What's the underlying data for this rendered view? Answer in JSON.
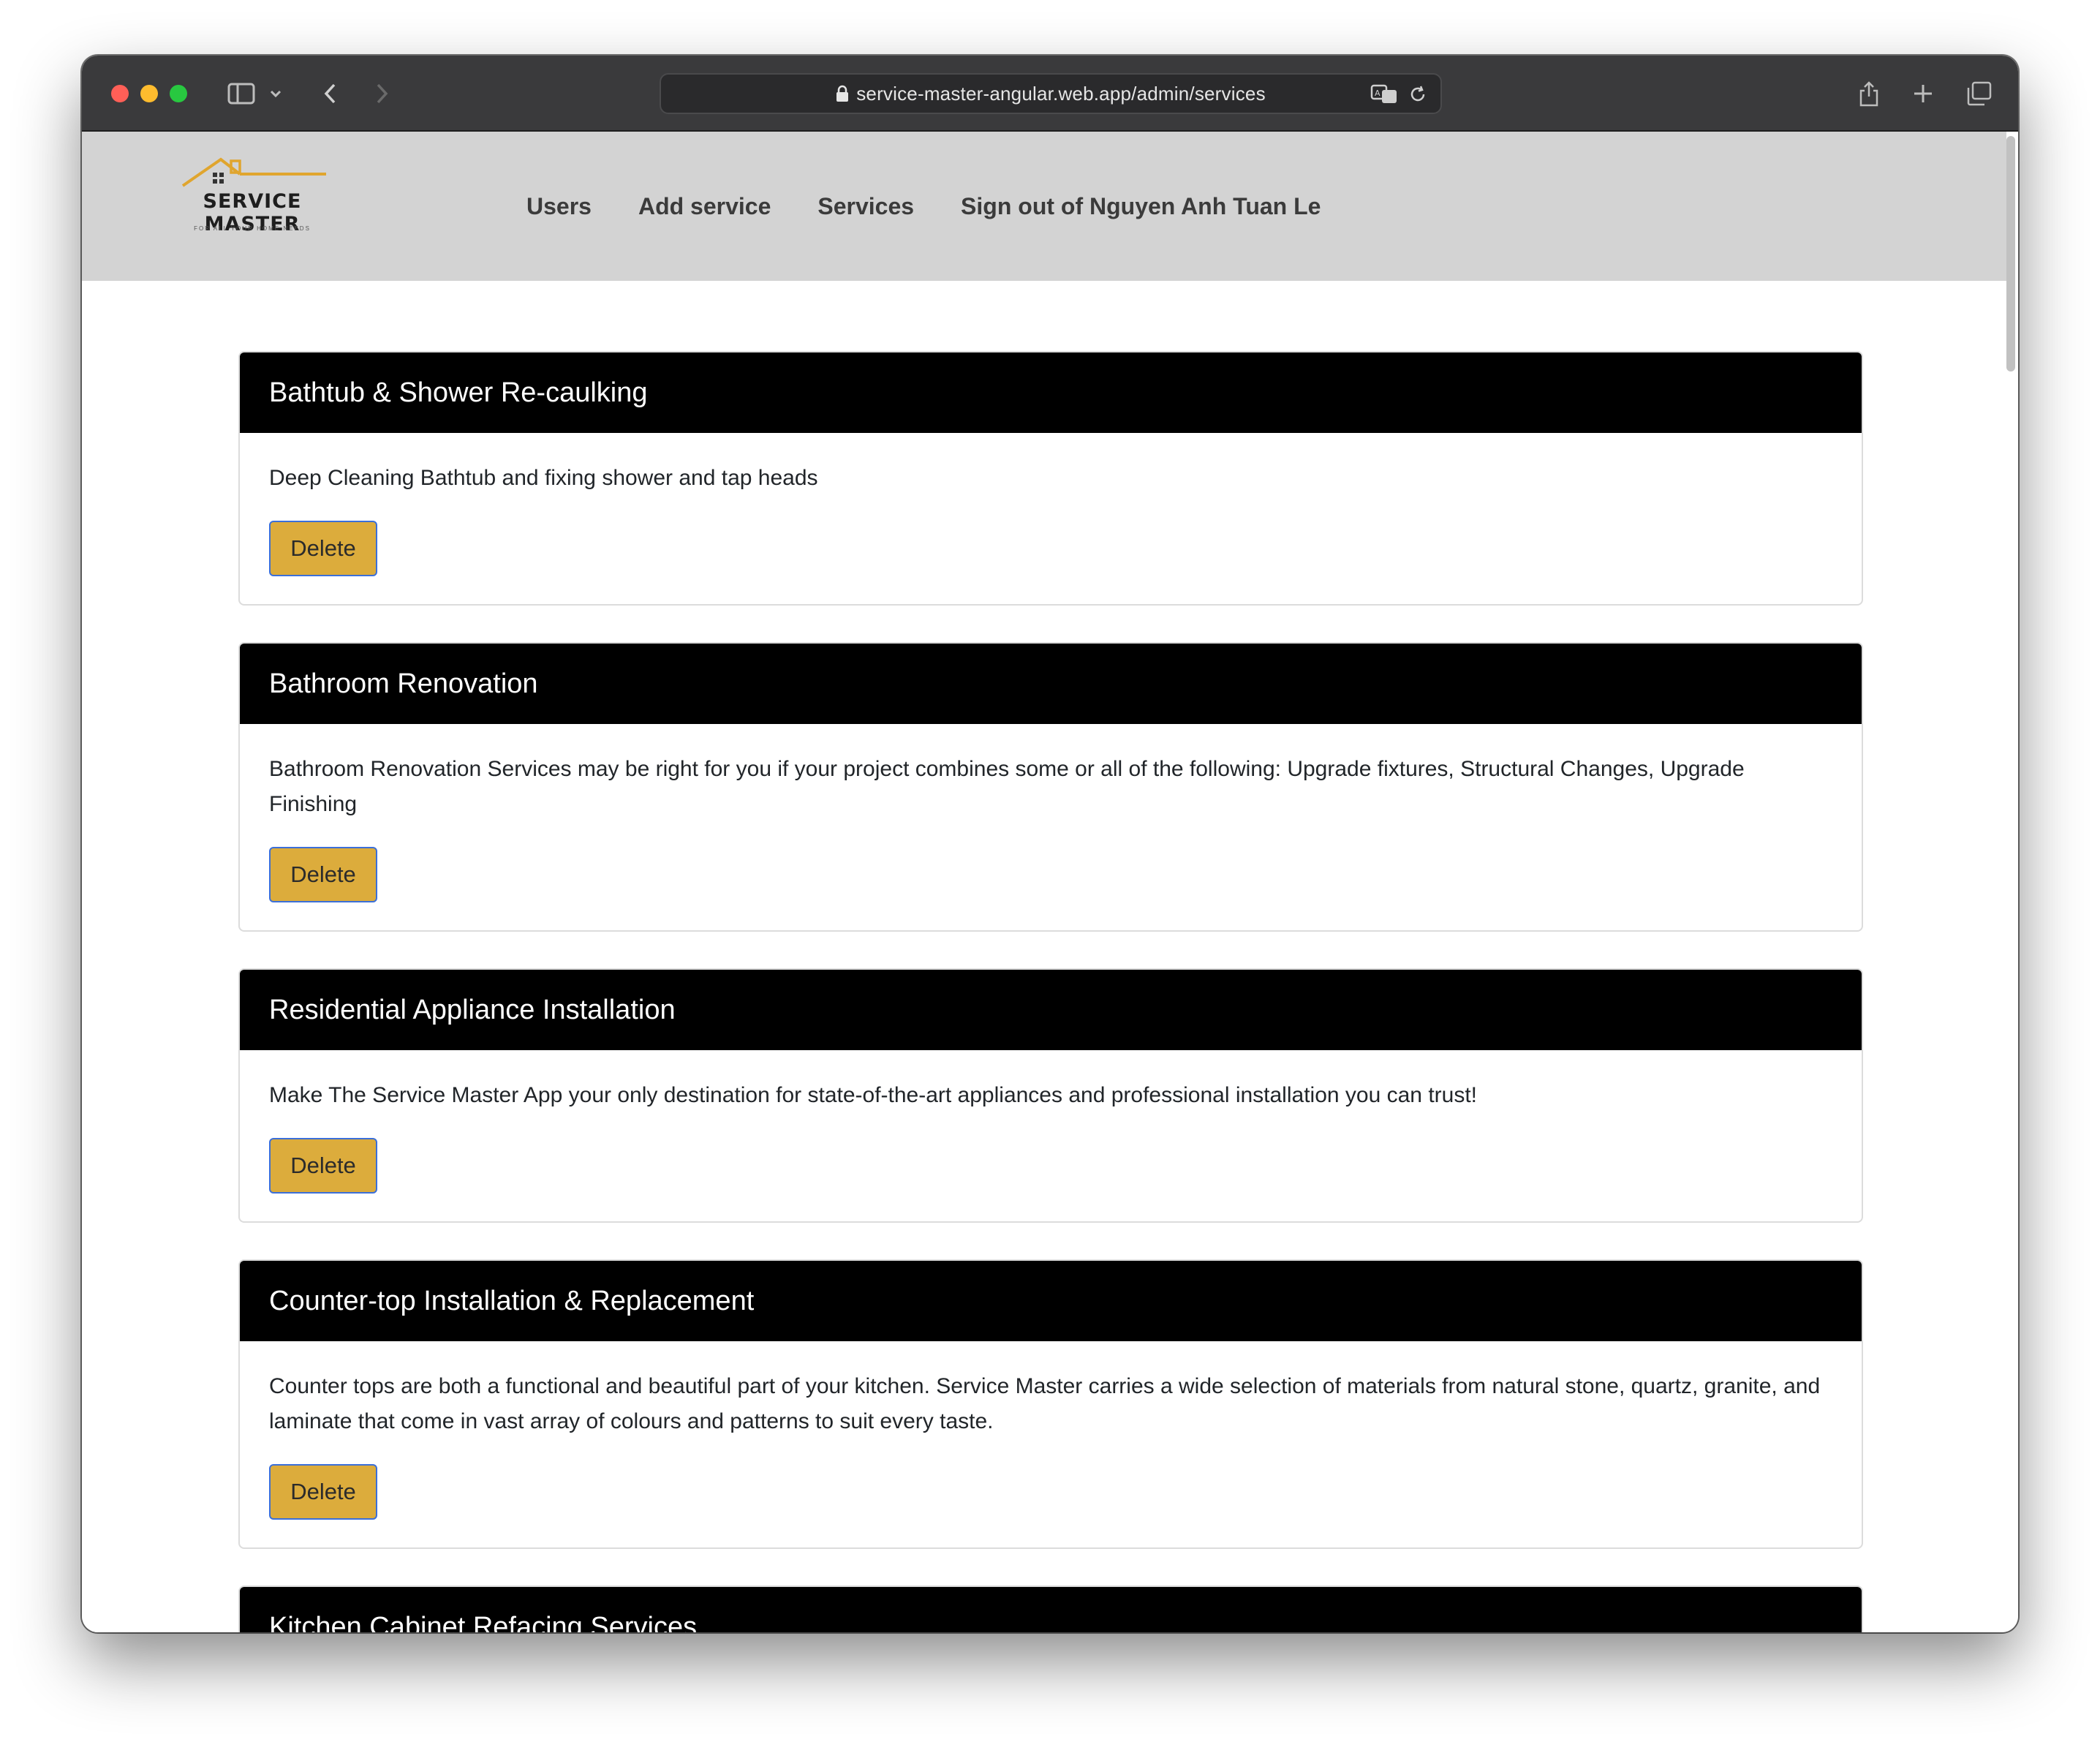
{
  "browser": {
    "url": "service-master-angular.web.app/admin/services"
  },
  "navbar": {
    "logo_title": "SERVICE MASTER",
    "logo_tagline": "FOR ALL YOUR HOME NEEDS",
    "links": [
      "Users",
      "Add service",
      "Services",
      "Sign out of Nguyen Anh Tuan Le"
    ]
  },
  "services": [
    {
      "title": "Bathtub & Shower Re-caulking",
      "description": "Deep Cleaning Bathtub and fixing shower and tap heads",
      "button": "Delete"
    },
    {
      "title": "Bathroom Renovation",
      "description": "Bathroom Renovation Services may be right for you if your project combines some or all of the following: Upgrade fixtures, Structural Changes, Upgrade Finishing",
      "button": "Delete"
    },
    {
      "title": "Residential Appliance Installation",
      "description": "Make The Service Master App your only destination for state-of-the-art appliances and professional installation you can trust!",
      "button": "Delete"
    },
    {
      "title": "Counter-top Installation & Replacement",
      "description": "Counter tops are both a functional and beautiful part of your kitchen. Service Master carries a wide selection of materials from natural stone, quartz, granite, and laminate that come in vast array of colours and patterns to suit every taste.",
      "button": "Delete"
    },
    {
      "title": "Kitchen Cabinet Refacing Services",
      "description": "",
      "button": ""
    }
  ],
  "colors": {
    "navbar_bg": "#d3d3d3",
    "card_header_bg": "#000000",
    "delete_button_bg": "#dcac3c",
    "logo_roof": "#e0a52e"
  }
}
